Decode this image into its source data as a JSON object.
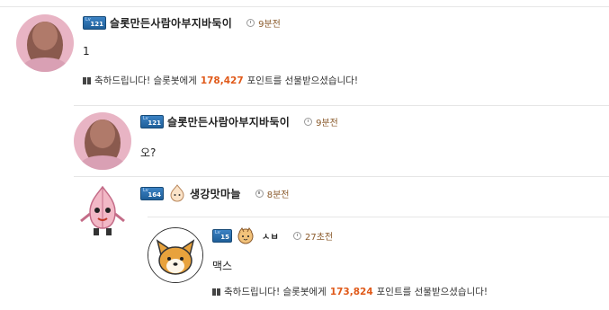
{
  "comments": [
    {
      "nickname": "슬롯만든사람아부지바둑이",
      "level_top": "Lv",
      "level": "121",
      "time": "9분전",
      "body": "1",
      "gift": {
        "prefix": "축하드립니다! 슬롯봇에게",
        "points": "178,427",
        "suffix": "포인트를 선물받으셨습니다!"
      }
    },
    {
      "nickname": "슬롯만든사람아부지바둑이",
      "level_top": "Lv",
      "level": "121",
      "time": "9분전",
      "body": "오?"
    },
    {
      "nickname": "생강맛마늘",
      "level_top": "Lv",
      "level": "164",
      "time": "8분전",
      "body": ""
    },
    {
      "nickname": "ㅅㅂ",
      "level_top": "Lv",
      "level": "15",
      "time": "27초전",
      "body": "맥스",
      "gift": {
        "prefix": "축하드립니다! 슬롯봇에게",
        "points": "173,824",
        "suffix": "포인트를 선물받으셨습니다!"
      }
    }
  ],
  "colors": {
    "points": "#e05a1a",
    "time": "#8a5a2b",
    "badge": "#1f5f99"
  },
  "icons": {
    "time": "clock-icon",
    "gift": "gift-icon",
    "level": "level-badge-icon"
  }
}
